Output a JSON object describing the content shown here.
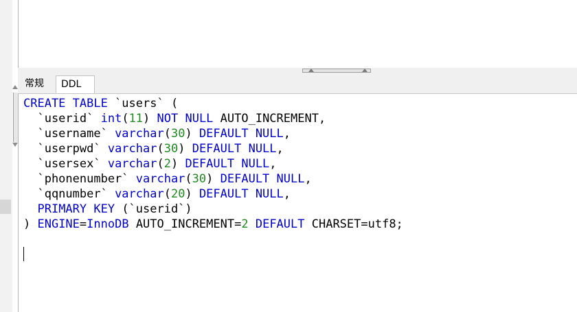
{
  "tabs": [
    {
      "label": "常规",
      "active": false
    },
    {
      "label": "DDL",
      "active": true
    }
  ],
  "ddl": {
    "lines": [
      [
        {
          "t": "CREATE TABLE",
          "c": "kw"
        },
        {
          "t": " `users` (",
          "c": "plain"
        }
      ],
      [
        {
          "t": "  `userid` ",
          "c": "plain"
        },
        {
          "t": "int",
          "c": "kw"
        },
        {
          "t": "(",
          "c": "plain"
        },
        {
          "t": "11",
          "c": "num"
        },
        {
          "t": ") ",
          "c": "plain"
        },
        {
          "t": "NOT NULL",
          "c": "kw"
        },
        {
          "t": " AUTO_INCREMENT,",
          "c": "plain"
        }
      ],
      [
        {
          "t": "  `username` ",
          "c": "plain"
        },
        {
          "t": "varchar",
          "c": "kw"
        },
        {
          "t": "(",
          "c": "plain"
        },
        {
          "t": "30",
          "c": "num"
        },
        {
          "t": ") ",
          "c": "plain"
        },
        {
          "t": "DEFAULT NULL",
          "c": "kw"
        },
        {
          "t": ",",
          "c": "plain"
        }
      ],
      [
        {
          "t": "  `userpwd` ",
          "c": "plain"
        },
        {
          "t": "varchar",
          "c": "kw"
        },
        {
          "t": "(",
          "c": "plain"
        },
        {
          "t": "30",
          "c": "num"
        },
        {
          "t": ") ",
          "c": "plain"
        },
        {
          "t": "DEFAULT NULL",
          "c": "kw"
        },
        {
          "t": ",",
          "c": "plain"
        }
      ],
      [
        {
          "t": "  `usersex` ",
          "c": "plain"
        },
        {
          "t": "varchar",
          "c": "kw"
        },
        {
          "t": "(",
          "c": "plain"
        },
        {
          "t": "2",
          "c": "num"
        },
        {
          "t": ") ",
          "c": "plain"
        },
        {
          "t": "DEFAULT NULL",
          "c": "kw"
        },
        {
          "t": ",",
          "c": "plain"
        }
      ],
      [
        {
          "t": "  `phonenumber` ",
          "c": "plain"
        },
        {
          "t": "varchar",
          "c": "kw"
        },
        {
          "t": "(",
          "c": "plain"
        },
        {
          "t": "30",
          "c": "num"
        },
        {
          "t": ") ",
          "c": "plain"
        },
        {
          "t": "DEFAULT NULL",
          "c": "kw"
        },
        {
          "t": ",",
          "c": "plain"
        }
      ],
      [
        {
          "t": "  `qqnumber` ",
          "c": "plain"
        },
        {
          "t": "varchar",
          "c": "kw"
        },
        {
          "t": "(",
          "c": "plain"
        },
        {
          "t": "20",
          "c": "num"
        },
        {
          "t": ") ",
          "c": "plain"
        },
        {
          "t": "DEFAULT NULL",
          "c": "kw"
        },
        {
          "t": ",",
          "c": "plain"
        }
      ],
      [
        {
          "t": "  ",
          "c": "plain"
        },
        {
          "t": "PRIMARY KEY",
          "c": "kw"
        },
        {
          "t": " (`userid`)",
          "c": "plain"
        }
      ],
      [
        {
          "t": ") ",
          "c": "plain"
        },
        {
          "t": "ENGINE",
          "c": "kw"
        },
        {
          "t": "=",
          "c": "plain"
        },
        {
          "t": "InnoDB",
          "c": "kw"
        },
        {
          "t": " AUTO_INCREMENT=",
          "c": "plain"
        },
        {
          "t": "2",
          "c": "num"
        },
        {
          "t": " ",
          "c": "plain"
        },
        {
          "t": "DEFAULT",
          "c": "kw"
        },
        {
          "t": " CHARSET=utf8;",
          "c": "plain"
        }
      ]
    ]
  },
  "colors": {
    "keyword": "#0000cc",
    "number": "#1f8a1f",
    "text": "#000000"
  }
}
